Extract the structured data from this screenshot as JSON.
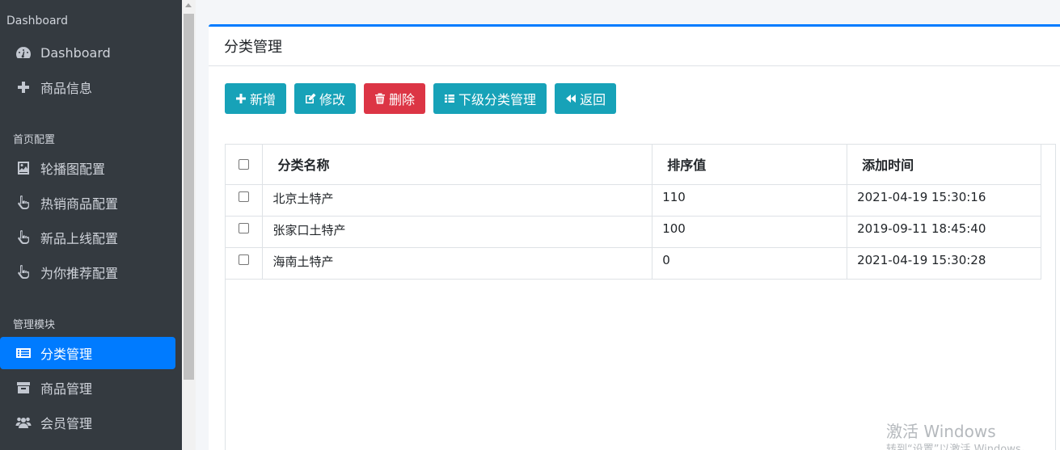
{
  "sidebar": {
    "header": "Dashboard",
    "items_top": [
      {
        "label": "Dashboard",
        "icon": "tachometer-icon"
      },
      {
        "label": "商品信息",
        "icon": "plus-icon"
      }
    ],
    "section_home": "首页配置",
    "items_home": [
      {
        "label": "轮播图配置",
        "icon": "image-icon"
      },
      {
        "label": "热销商品配置",
        "icon": "hand-pointer-icon"
      },
      {
        "label": "新品上线配置",
        "icon": "hand-pointer-icon"
      },
      {
        "label": "为你推荐配置",
        "icon": "hand-pointer-icon"
      }
    ],
    "section_manage": "管理模块",
    "items_manage": [
      {
        "label": "分类管理",
        "icon": "list-icon",
        "active": true
      },
      {
        "label": "商品管理",
        "icon": "archive-icon"
      },
      {
        "label": "会员管理",
        "icon": "users-icon"
      }
    ]
  },
  "card": {
    "title": "分类管理"
  },
  "toolbar": {
    "add": "新增",
    "edit": "修改",
    "delete": "删除",
    "sub": "下级分类管理",
    "back": "返回"
  },
  "table": {
    "headers": [
      "分类名称",
      "排序值",
      "添加时间"
    ],
    "rows": [
      {
        "name": "北京土特产",
        "rank": "110",
        "time": "2021-04-19 15:30:16"
      },
      {
        "name": "张家口土特产",
        "rank": "100",
        "time": "2019-09-11 18:45:40"
      },
      {
        "name": "海南土特产",
        "rank": "0",
        "time": "2021-04-19 15:30:28"
      }
    ]
  },
  "watermark": {
    "line1": "激活 Windows",
    "line2": "转到“设置”以激活 Windows。"
  },
  "colors": {
    "sidebar_bg": "#343a40",
    "active": "#007bff",
    "info": "#17a2b8",
    "danger": "#dc3545"
  }
}
